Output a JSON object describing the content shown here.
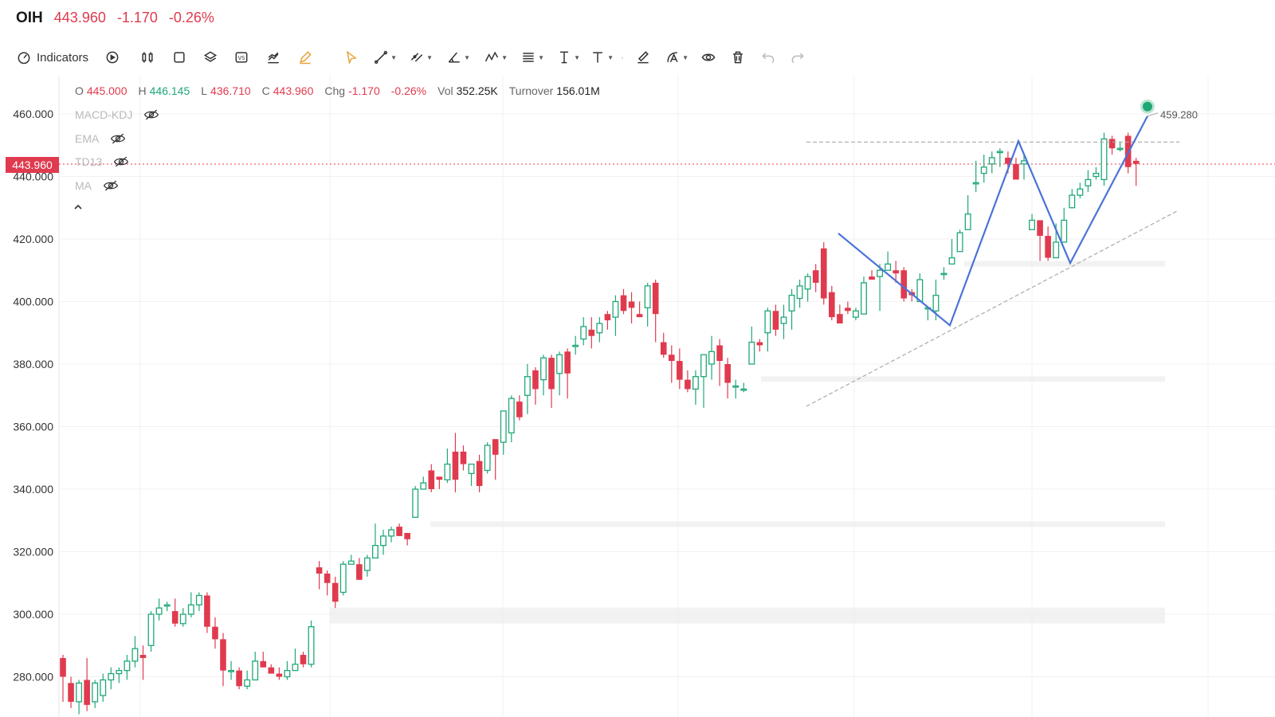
{
  "header": {
    "symbol": "OIH",
    "price": "443.960",
    "change": "-1.170",
    "change_pct": "-0.26%"
  },
  "toolbar": {
    "indicators_label": "Indicators"
  },
  "ohlc": {
    "open_label": "O",
    "open": "445.000",
    "high_label": "H",
    "high": "446.145",
    "low_label": "L",
    "low": "436.710",
    "close_label": "C",
    "close": "443.960",
    "chg_label": "Chg",
    "chg": "-1.170",
    "chg_pct": "-0.26%",
    "vol_label": "Vol",
    "vol": "352.25K",
    "turnover_label": "Turnover",
    "turnover": "156.01M"
  },
  "indicators": [
    "MACD-KDJ",
    "EMA",
    "TD13",
    "MA"
  ],
  "price_tag": "443.960",
  "peak_label": "459.280",
  "colors": {
    "up": "#1fa876",
    "down": "#e03a4e",
    "pattern": "#4a72d8",
    "accent": "#e8a33a"
  },
  "chart_data": {
    "type": "candlestick",
    "ylim": [
      276,
      466
    ],
    "y_ticks": [
      "460.000",
      "440.000",
      "420.000",
      "400.000",
      "380.000",
      "360.000",
      "340.000",
      "320.000",
      "300.000",
      "280.000"
    ],
    "last_price": 443.96,
    "peak_value": 459.28,
    "candles": [
      [
        286,
        280,
        287,
        272
      ],
      [
        278,
        272,
        280,
        270
      ],
      [
        272,
        278,
        279,
        268
      ],
      [
        279,
        271,
        286,
        269
      ],
      [
        272,
        278,
        279,
        270
      ],
      [
        274,
        279,
        281,
        272
      ],
      [
        279,
        281,
        283,
        276
      ],
      [
        281,
        282,
        283,
        278
      ],
      [
        282,
        285,
        287,
        279
      ],
      [
        285,
        289,
        293,
        283
      ],
      [
        287,
        286,
        290,
        279
      ],
      [
        290,
        300,
        301,
        288
      ],
      [
        300,
        302,
        305,
        298
      ],
      [
        303,
        303,
        304,
        301
      ],
      [
        301,
        297,
        305,
        296
      ],
      [
        297,
        300,
        302,
        296
      ],
      [
        300,
        303,
        307,
        299
      ],
      [
        303,
        306,
        307,
        301
      ],
      [
        306,
        296,
        307,
        294
      ],
      [
        296,
        292,
        299,
        289
      ],
      [
        292,
        282,
        294,
        277
      ],
      [
        282,
        282,
        285,
        279
      ],
      [
        282,
        277,
        283,
        276
      ],
      [
        277,
        279,
        282,
        276
      ],
      [
        279,
        285,
        288,
        279
      ],
      [
        285,
        283,
        288,
        283
      ],
      [
        283,
        281,
        284,
        281
      ],
      [
        281,
        280,
        283,
        279
      ],
      [
        280,
        282,
        285,
        279
      ],
      [
        282,
        284,
        289,
        282
      ],
      [
        287,
        284,
        288,
        283
      ],
      [
        284,
        296,
        298,
        283
      ],
      [
        315,
        313,
        317,
        308
      ],
      [
        313,
        310,
        314,
        306
      ],
      [
        310,
        304,
        312,
        302
      ],
      [
        307,
        316,
        317,
        306
      ],
      [
        316,
        317,
        319,
        316
      ],
      [
        316,
        311,
        318,
        312
      ],
      [
        314,
        318,
        319,
        312
      ],
      [
        318,
        322,
        329,
        319
      ],
      [
        322,
        325,
        327,
        319
      ],
      [
        325,
        327,
        328,
        323
      ],
      [
        328,
        325,
        329,
        325
      ],
      [
        326,
        324,
        325,
        322
      ],
      [
        331,
        340,
        341,
        331
      ],
      [
        340,
        342,
        344,
        340
      ],
      [
        346,
        340,
        348,
        339
      ],
      [
        344,
        343,
        344,
        340
      ],
      [
        343,
        348,
        353,
        342
      ],
      [
        352,
        343,
        358,
        339
      ],
      [
        352,
        348,
        354,
        346
      ],
      [
        345,
        348,
        347,
        341
      ],
      [
        349,
        341,
        351,
        339
      ],
      [
        346,
        354,
        355,
        345
      ],
      [
        356,
        351,
        356,
        343
      ],
      [
        355,
        365,
        361,
        351
      ],
      [
        358,
        369,
        370,
        355
      ],
      [
        368,
        363,
        370,
        362
      ],
      [
        370,
        376,
        380,
        364
      ],
      [
        378,
        372,
        379,
        367
      ],
      [
        375,
        382,
        383,
        370
      ],
      [
        382,
        372,
        383,
        366
      ],
      [
        377,
        383,
        384,
        370
      ],
      [
        384,
        377,
        385,
        369
      ],
      [
        386,
        386,
        389,
        383
      ],
      [
        388,
        392,
        395,
        386
      ],
      [
        391,
        389,
        395,
        385
      ],
      [
        390,
        393,
        395,
        387
      ],
      [
        396,
        394,
        397,
        391
      ],
      [
        395,
        400,
        402,
        389
      ],
      [
        402,
        397,
        404,
        396
      ],
      [
        400,
        398,
        403,
        393
      ],
      [
        396,
        395,
        400,
        396
      ],
      [
        398,
        405,
        406,
        392
      ],
      [
        406,
        396,
        407,
        387
      ],
      [
        387,
        383,
        390,
        382
      ],
      [
        383,
        381,
        386,
        374
      ],
      [
        381,
        375,
        385,
        372
      ],
      [
        375,
        372,
        378,
        371
      ],
      [
        372,
        376,
        378,
        367
      ],
      [
        376,
        383,
        380,
        366
      ],
      [
        380,
        384,
        389,
        375
      ],
      [
        386,
        381,
        388,
        373
      ],
      [
        380,
        374,
        382,
        369
      ],
      [
        373,
        373,
        375,
        369
      ],
      [
        372,
        372,
        374,
        371
      ],
      [
        380,
        387,
        392,
        380
      ],
      [
        387,
        386,
        388,
        384
      ],
      [
        390,
        397,
        398,
        384
      ],
      [
        397,
        391,
        399,
        389
      ],
      [
        393,
        395,
        399,
        388
      ],
      [
        397,
        402,
        404,
        391
      ],
      [
        401,
        405,
        407,
        398
      ],
      [
        404,
        408,
        409,
        400
      ],
      [
        410,
        406,
        412,
        403
      ],
      [
        417,
        401,
        419,
        399
      ],
      [
        403,
        395,
        405,
        394
      ],
      [
        396,
        393,
        399,
        395
      ],
      [
        398,
        397,
        400,
        396
      ],
      [
        395,
        397,
        398,
        394
      ],
      [
        396,
        406,
        408,
        396
      ],
      [
        408,
        407,
        410,
        408
      ],
      [
        408,
        410,
        412,
        397
      ],
      [
        410,
        412,
        416,
        413
      ],
      [
        410,
        409,
        413,
        406
      ],
      [
        410,
        401,
        411,
        400
      ],
      [
        403,
        402,
        404,
        400
      ],
      [
        400,
        407,
        409,
        402
      ],
      [
        398,
        398,
        398,
        394
      ],
      [
        397,
        402,
        407,
        394
      ],
      [
        409,
        409,
        411,
        407
      ],
      [
        412,
        414,
        420,
        414
      ],
      [
        416,
        422,
        423,
        417
      ],
      [
        423,
        428,
        434,
        425
      ],
      [
        438,
        438,
        445,
        435
      ],
      [
        441,
        443,
        447,
        438
      ],
      [
        444,
        446,
        448,
        441
      ],
      [
        448,
        448,
        449,
        443
      ],
      [
        446,
        444,
        448,
        441
      ],
      [
        444,
        439,
        446,
        440
      ],
      [
        444,
        445,
        447,
        439
      ],
      [
        423,
        426,
        428,
        427
      ],
      [
        426,
        421,
        423,
        413
      ],
      [
        421,
        414,
        424,
        413
      ],
      [
        414,
        419,
        425,
        418
      ],
      [
        419,
        426,
        430,
        419
      ],
      [
        430,
        434,
        436,
        432
      ],
      [
        434,
        436,
        438,
        433
      ],
      [
        437,
        439,
        442,
        435
      ],
      [
        440,
        441,
        443,
        439
      ],
      [
        439,
        452,
        454,
        437
      ],
      [
        452,
        449,
        453,
        447
      ],
      [
        449,
        449,
        451,
        448
      ],
      [
        453,
        443,
        454,
        441
      ],
      [
        445,
        444,
        446,
        437
      ]
    ],
    "gray_bands": [
      299.6,
      328.8,
      375.2,
      412.1
    ],
    "pattern_points": [
      [
        1052,
        421.8
      ],
      [
        1192,
        392.4
      ],
      [
        1278,
        451.3
      ],
      [
        1343,
        412.3
      ],
      [
        1440,
        459.3
      ]
    ],
    "resistance_level": 451.0,
    "trendline": [
      [
        1012,
        366.5
      ],
      [
        1479,
        429.2
      ]
    ]
  }
}
